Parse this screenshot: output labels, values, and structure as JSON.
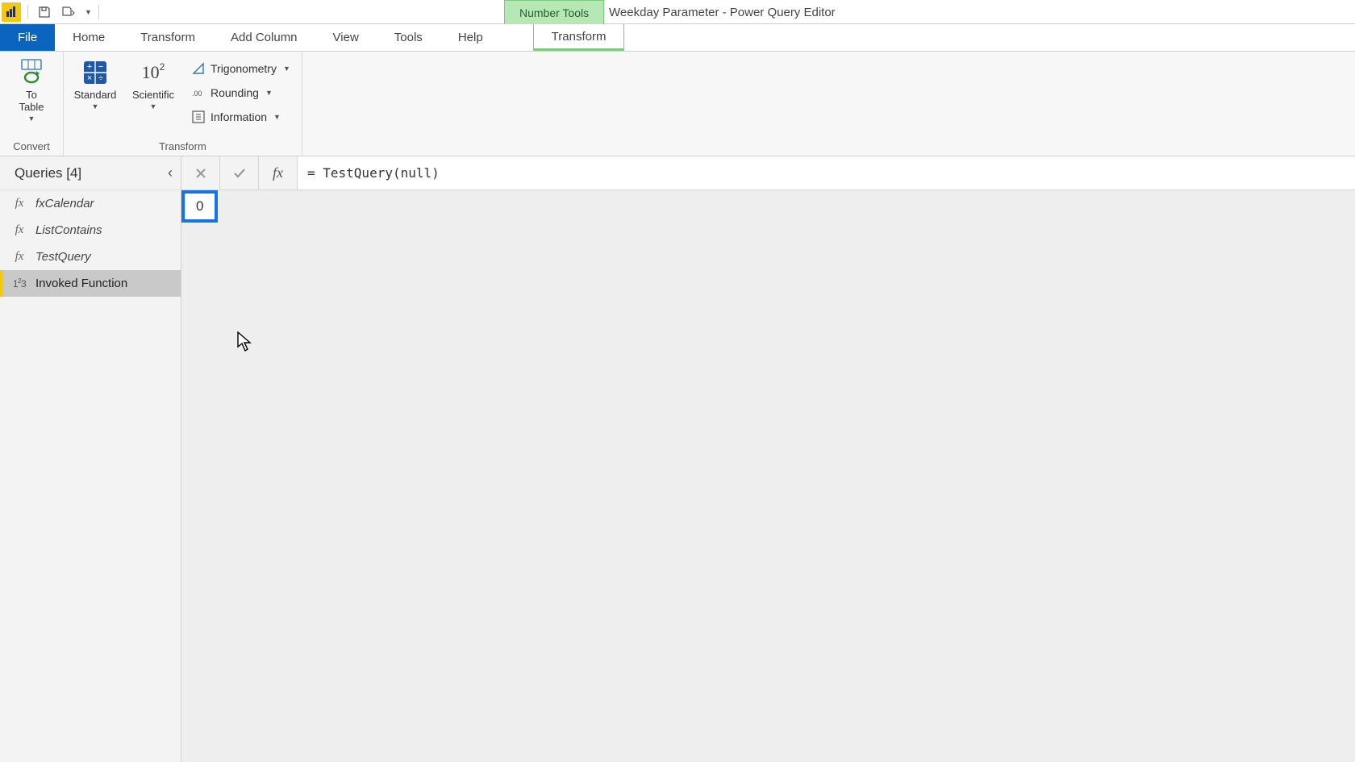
{
  "titlebar": {
    "context_tool_label": "Number Tools",
    "window_title": "Weekday Parameter - Power Query Editor"
  },
  "tabs": {
    "file": "File",
    "home": "Home",
    "transform": "Transform",
    "add_column": "Add Column",
    "view": "View",
    "tools": "Tools",
    "help": "Help",
    "context_transform": "Transform"
  },
  "ribbon": {
    "convert": {
      "to_table": "To\nTable",
      "group_label": "Convert"
    },
    "transform": {
      "standard": "Standard",
      "scientific": "Scientific",
      "trigonometry": "Trigonometry",
      "rounding": "Rounding",
      "information": "Information",
      "group_label": "Transform"
    }
  },
  "queries": {
    "header": "Queries [4]",
    "items": [
      {
        "icon": "fx",
        "label": "fxCalendar"
      },
      {
        "icon": "fx",
        "label": "ListContains"
      },
      {
        "icon": "fx",
        "label": "TestQuery"
      },
      {
        "icon": "123",
        "label": "Invoked Function"
      }
    ]
  },
  "formula": "= TestQuery(null)",
  "result_value": "0"
}
